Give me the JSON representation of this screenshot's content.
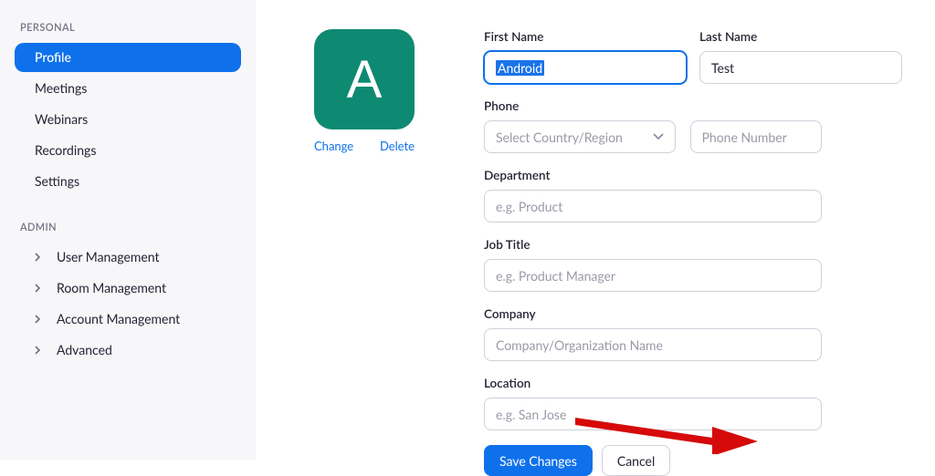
{
  "sidebar": {
    "personal_label": "PERSONAL",
    "admin_label": "ADMIN",
    "personal": [
      {
        "label": "Profile",
        "active": true
      },
      {
        "label": "Meetings",
        "active": false
      },
      {
        "label": "Webinars",
        "active": false
      },
      {
        "label": "Recordings",
        "active": false
      },
      {
        "label": "Settings",
        "active": false
      }
    ],
    "admin": [
      {
        "label": "User Management"
      },
      {
        "label": "Room Management"
      },
      {
        "label": "Account Management"
      },
      {
        "label": "Advanced"
      }
    ]
  },
  "avatar": {
    "letter": "A",
    "change": "Change",
    "delete": "Delete"
  },
  "form": {
    "first_name_label": "First Name",
    "first_name_value": "Android",
    "last_name_label": "Last Name",
    "last_name_value": "Test",
    "phone_label": "Phone",
    "phone_select": "Select Country/Region",
    "phone_placeholder": "Phone Number",
    "department_label": "Department",
    "department_placeholder": "e.g. Product",
    "jobtitle_label": "Job Title",
    "jobtitle_placeholder": "e.g. Product Manager",
    "company_label": "Company",
    "company_placeholder": "Company/Organization Name",
    "location_label": "Location",
    "location_placeholder": "e.g. San Jose",
    "save": "Save Changes",
    "cancel": "Cancel"
  }
}
